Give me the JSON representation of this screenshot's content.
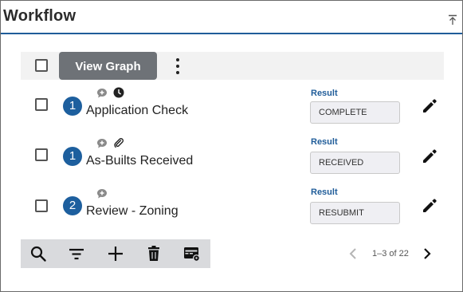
{
  "panel": {
    "title": "Workflow"
  },
  "toolbar": {
    "view_graph_label": "View Graph"
  },
  "tasks": [
    {
      "step": "1",
      "name": "Application Check",
      "result_label": "Result",
      "result_value": "COMPLETE",
      "icons": [
        "comment-add-icon",
        "clock-icon"
      ]
    },
    {
      "step": "1",
      "name": "As-Builts Received",
      "result_label": "Result",
      "result_value": "RECEIVED",
      "icons": [
        "comment-add-icon",
        "paperclip-icon"
      ]
    },
    {
      "step": "2",
      "name": "Review - Zoning",
      "result_label": "Result",
      "result_value": "RESUBMIT",
      "icons": [
        "comment-add-icon"
      ]
    }
  ],
  "bottom_toolbar": {
    "icons": [
      "search-icon",
      "filter-icon",
      "add-icon",
      "delete-icon",
      "column-settings-icon"
    ]
  },
  "pagination": {
    "text": "1–3 of 22"
  },
  "colors": {
    "accent": "#1f5c99",
    "badge": "#1d5f9e",
    "button": "#6e7277"
  }
}
